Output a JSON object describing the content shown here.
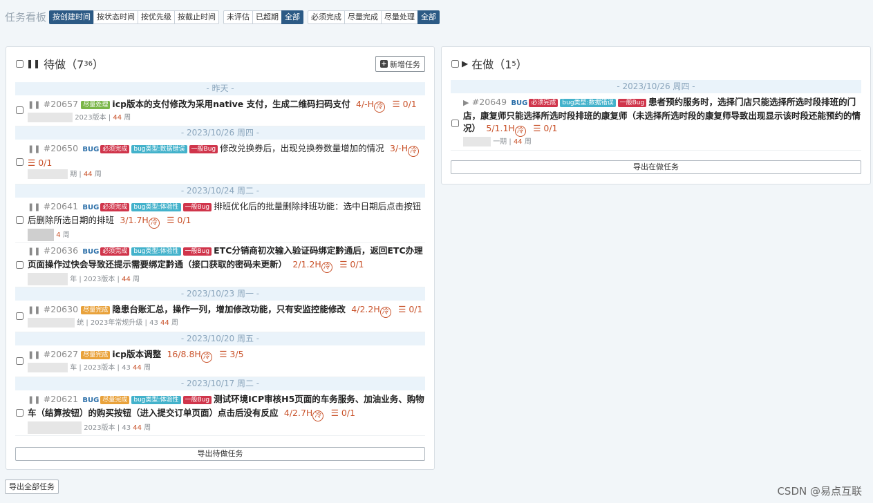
{
  "board_title": "任务看板",
  "sort_group": [
    "按创建时间",
    "按状态时间",
    "按优先级",
    "按截止时间"
  ],
  "estimate_group": [
    "未评估",
    "已超期",
    "全部"
  ],
  "priority_group": [
    "必须完成",
    "尽量完成",
    "尽量处理",
    "全部"
  ],
  "todo": {
    "title": "待做（7",
    "count_sup": "36",
    "title_end": "）",
    "new_task": "新增任务",
    "export": "导出待做任务",
    "dates": [
      "- 昨天 -",
      "- 2023/10/26 周四 -",
      "- 2023/10/24 周二 -",
      "- 2023/10/23 周一 -",
      "- 2023/10/20 周五 -",
      "- 2023/10/17 周二 -"
    ],
    "tasks": [
      {
        "id": "#20657",
        "tags": [
          "尽量处理"
        ],
        "text": "icp版本的支付修改为采用native 支付，生成二维码扫码支付",
        "est": "4/-H",
        "sub": "0/1",
        "meta": "2023版本 |",
        "days": "44",
        "unit": "周"
      },
      {
        "id": "#20650",
        "bug": "BUG",
        "tags": [
          "必须完成",
          "bug类型:数据错误",
          "一般Bug"
        ],
        "text": "修改兑换券后，出现兑换券数量增加的情况",
        "est": "3/-H",
        "sub": "0/1",
        "meta": "期 |",
        "days": "44",
        "unit": "周"
      },
      {
        "id": "#20641",
        "bug": "BUG",
        "tags": [
          "必须完成",
          "bug类型:体验性",
          "一般Bug"
        ],
        "text": "排班优化后的批量删除排班功能：选中日期后点击按钮后删除所选日期的排班",
        "est": "3/1.7H",
        "sub": "0/1",
        "meta": "",
        "days": "4",
        "unit": "周"
      },
      {
        "id": "#20636",
        "bug": "BUG",
        "tags": [
          "必须完成",
          "bug类型:体验性",
          "一般Bug"
        ],
        "text": "ETC分销商初次输入验证码绑定黔通后，返回ETC办理页面操作过快会导致还提示需要绑定黔通（接口获取的密码未更新）",
        "est": "2/1.2H",
        "sub": "0/1",
        "meta": "年 | 2023版本 |",
        "days": "44",
        "unit": "周"
      },
      {
        "id": "#20630",
        "tags": [
          "尽量完成"
        ],
        "text": "隐患台账汇总，操作一列，增加修改功能，只有安监控能修改",
        "est": "4/2.2H",
        "sub": "0/1",
        "meta": "统 | 2023年常规升级 | 43",
        "days": "44",
        "unit": "周"
      },
      {
        "id": "#20627",
        "tags": [
          "尽量完成"
        ],
        "text": "icp版本调整",
        "est": "16/8.8H",
        "sub": "3/5",
        "meta": "车 | 2023版本 | 43",
        "days": "44",
        "unit": "周"
      },
      {
        "id": "#20621",
        "bug": "BUG",
        "tags": [
          "尽量完成",
          "bug类型:体验性",
          "一般Bug"
        ],
        "text": "测试环境ICP审核H5页面的车务服务、加油业务、购物车（结算按钮）的购买按钮（进入提交订单页面）点击后没有反应",
        "est": "4/2.7H",
        "sub": "0/1",
        "meta": "2023版本 | 43",
        "days": "44",
        "unit": "周"
      }
    ]
  },
  "doing": {
    "title": "在做（1",
    "count_sup": "5",
    "title_end": "）",
    "export": "导出在做任务",
    "dates": [
      "- 2023/10/26 周四 -"
    ],
    "tasks": [
      {
        "id": "#20649",
        "bug": "BUG",
        "tags": [
          "必须完成",
          "bug类型:数据错误",
          "一般Bug"
        ],
        "text": "患者预约服务时，选择门店只能选择所选时段排班的门店，康复师只能选择所选时段排班的康复师（未选择所选时段的康复师导致出现显示该时段还能预约的情况）",
        "est": "5/1.1H",
        "sub": "0/1",
        "meta": "一期 |",
        "days": "44",
        "unit": "周"
      }
    ]
  },
  "cold_glyph": "冷",
  "list_glyph": "☰",
  "export_all": "导出全部任务",
  "watermark": "CSDN @易点互联",
  "colors": {
    "accent": "#2c5a85",
    "estimate": "#c9532b",
    "date_row": "#eaf3fa"
  }
}
